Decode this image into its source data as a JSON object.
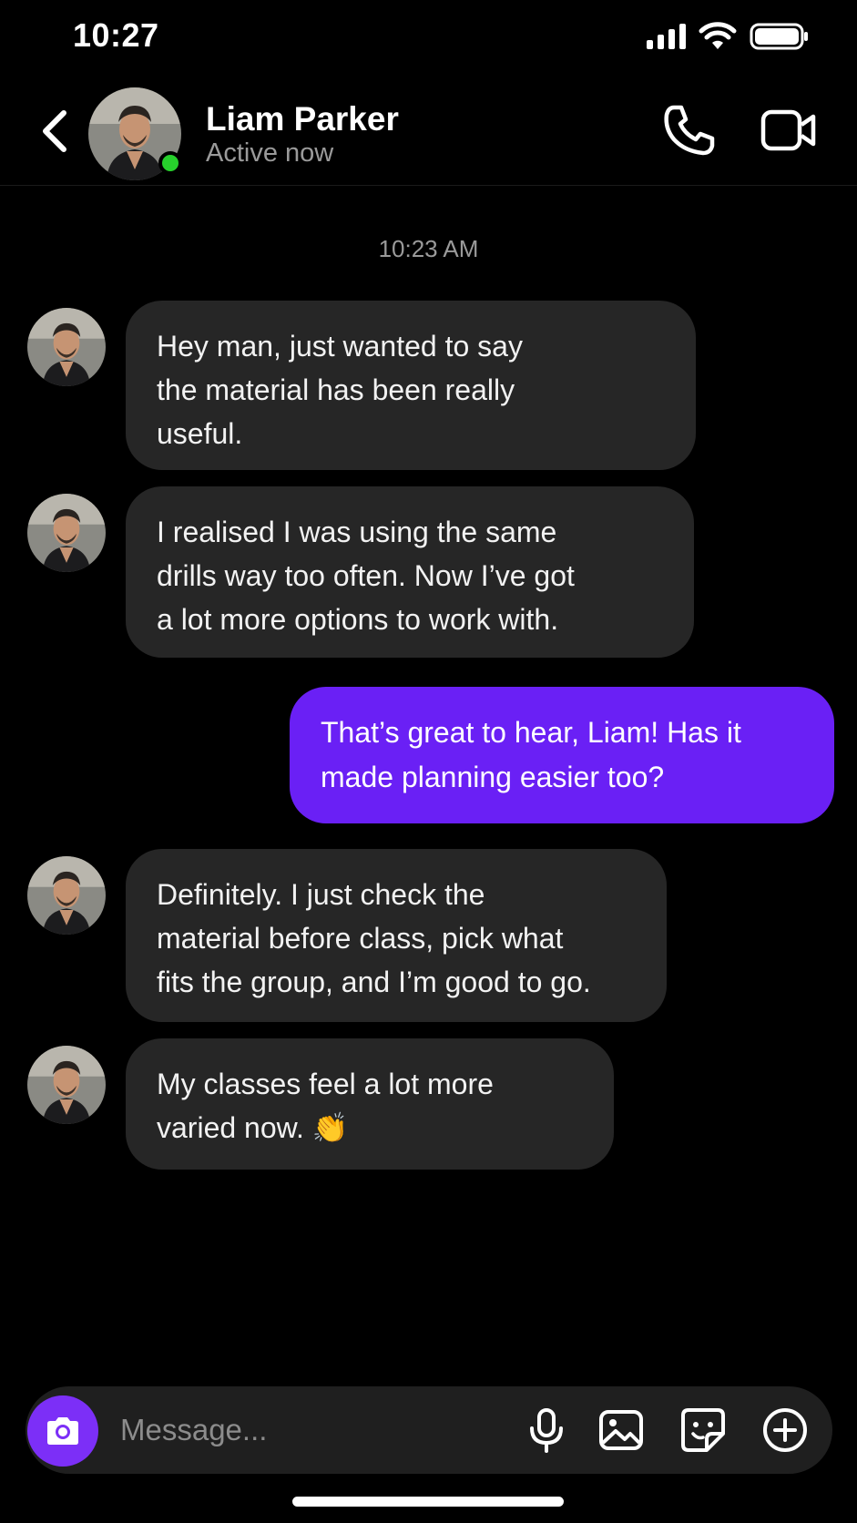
{
  "status_bar": {
    "time": "10:27"
  },
  "header": {
    "contact_name": "Liam Parker",
    "contact_status": "Active now"
  },
  "conversation": {
    "timestamp": "10:23 AM",
    "messages": [
      {
        "direction": "incoming",
        "text": "Hey man, just wanted to say\nthe material has been really\nuseful."
      },
      {
        "direction": "incoming",
        "text": "I realised I was using the same\ndrills way too often. Now I’ve got\na lot more options to work with."
      },
      {
        "direction": "outgoing",
        "text": "That’s great to hear, Liam! Has it\nmade planning easier too?"
      },
      {
        "direction": "incoming",
        "text": "Definitely. I just check the\nmaterial before class, pick what\nfits the group, and I’m good to go."
      },
      {
        "direction": "incoming",
        "text": "My classes feel a lot more\nvaried now. 👏"
      }
    ]
  },
  "composer": {
    "placeholder": "Message...",
    "icons": [
      "camera-icon",
      "microphone-icon",
      "gallery-icon",
      "sticker-icon",
      "plus-icon"
    ]
  },
  "colors": {
    "accent": "#6a20f5",
    "incoming_bubble": "#262626",
    "presence": "#27d12c"
  }
}
